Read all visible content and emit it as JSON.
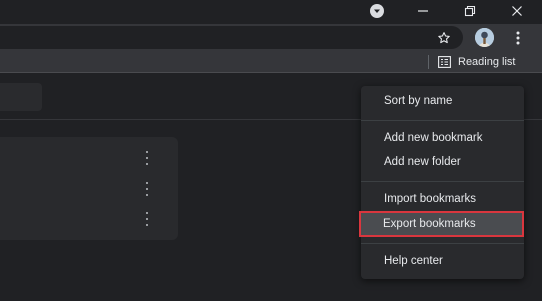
{
  "window": {
    "profile_icon": "chevron-down-circle-icon",
    "minimize_icon": "minimize-icon",
    "restore_icon": "restore-icon",
    "close_icon": "close-icon"
  },
  "toolbar": {
    "star_icon": "star-outline-icon",
    "avatar_icon": "profile-avatar",
    "menu_icon": "kebab-menu-icon"
  },
  "bookmarks_bar": {
    "reading_list_label": "Reading list",
    "reading_list_icon": "reading-list-icon"
  },
  "menu": {
    "items": [
      {
        "label": "Sort by name"
      },
      {
        "label": "Add new bookmark"
      },
      {
        "label": "Add new folder"
      },
      {
        "label": "Import bookmarks"
      },
      {
        "label": "Export bookmarks",
        "highlighted": true
      },
      {
        "label": "Help center"
      }
    ]
  },
  "colors": {
    "background": "#202124",
    "toolbar": "#35363a",
    "menu": "#292a2d",
    "highlight_outline": "#d9363e"
  }
}
